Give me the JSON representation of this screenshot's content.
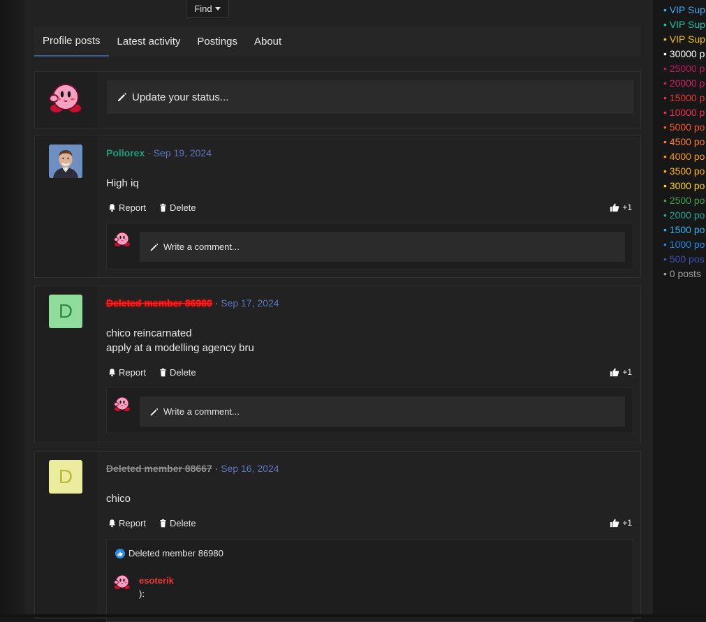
{
  "find_button": {
    "label": "Find"
  },
  "tabs": [
    {
      "label": "Profile posts"
    },
    {
      "label": "Latest activity"
    },
    {
      "label": "Postings"
    },
    {
      "label": "About"
    }
  ],
  "status_input": {
    "placeholder": "Update your status..."
  },
  "posts": [
    {
      "author": "Pollorex",
      "date": "Sep 19, 2024",
      "lines": [
        "High iq"
      ],
      "report_label": "Report",
      "delete_label": "Delete",
      "reaction": "+1",
      "comment_placeholder": "Write a comment..."
    },
    {
      "author": "Deleted member 86980",
      "avatar_letter": "D",
      "date": "Sep 17, 2024",
      "lines": [
        "chico reincarnated",
        "apply at a modelling agency bru"
      ],
      "report_label": "Report",
      "delete_label": "Delete",
      "reaction": "+1",
      "comment_placeholder": "Write a comment..."
    },
    {
      "author": "Deleted member 88667",
      "avatar_letter": "D",
      "date": "Sep 16, 2024",
      "lines": [
        "chico"
      ],
      "report_label": "Report",
      "delete_label": "Delete",
      "reaction": "+1",
      "reacted_by": "Deleted member 86980",
      "comment": {
        "author": "esoterik",
        "text": "):"
      }
    }
  ],
  "legend": [
    {
      "label": "• VIP Sup",
      "color": "#3fa9f5"
    },
    {
      "label": "• VIP Sup",
      "color": "#19c3a8"
    },
    {
      "label": "• VIP Sup",
      "color": "#f5c400"
    },
    {
      "label": "• 30000 p",
      "color": "#ffffff"
    },
    {
      "label": "• 25000 p",
      "color": "#c2185b"
    },
    {
      "label": "• 20000 p",
      "color": "#d81b60"
    },
    {
      "label": "• 15000 p",
      "color": "#e53935"
    },
    {
      "label": "• 10000 p",
      "color": "#f0304a"
    },
    {
      "label": "• 5000 po",
      "color": "#ff5722"
    },
    {
      "label": "• 4500 po",
      "color": "#ff7a30"
    },
    {
      "label": "• 4000 po",
      "color": "#ff9800"
    },
    {
      "label": "• 3500 po",
      "color": "#ffb300"
    },
    {
      "label": "• 3000 po",
      "color": "#ffd600"
    },
    {
      "label": "• 2500 po",
      "color": "#43a047"
    },
    {
      "label": "• 2000 po",
      "color": "#26a69a"
    },
    {
      "label": "• 1500 po",
      "color": "#29b6f6"
    },
    {
      "label": "• 1000 po",
      "color": "#1e88e5"
    },
    {
      "label": "• 500 pos",
      "color": "#3f51b5"
    },
    {
      "label": "• 0 posts",
      "color": "#9e9e9e"
    }
  ]
}
